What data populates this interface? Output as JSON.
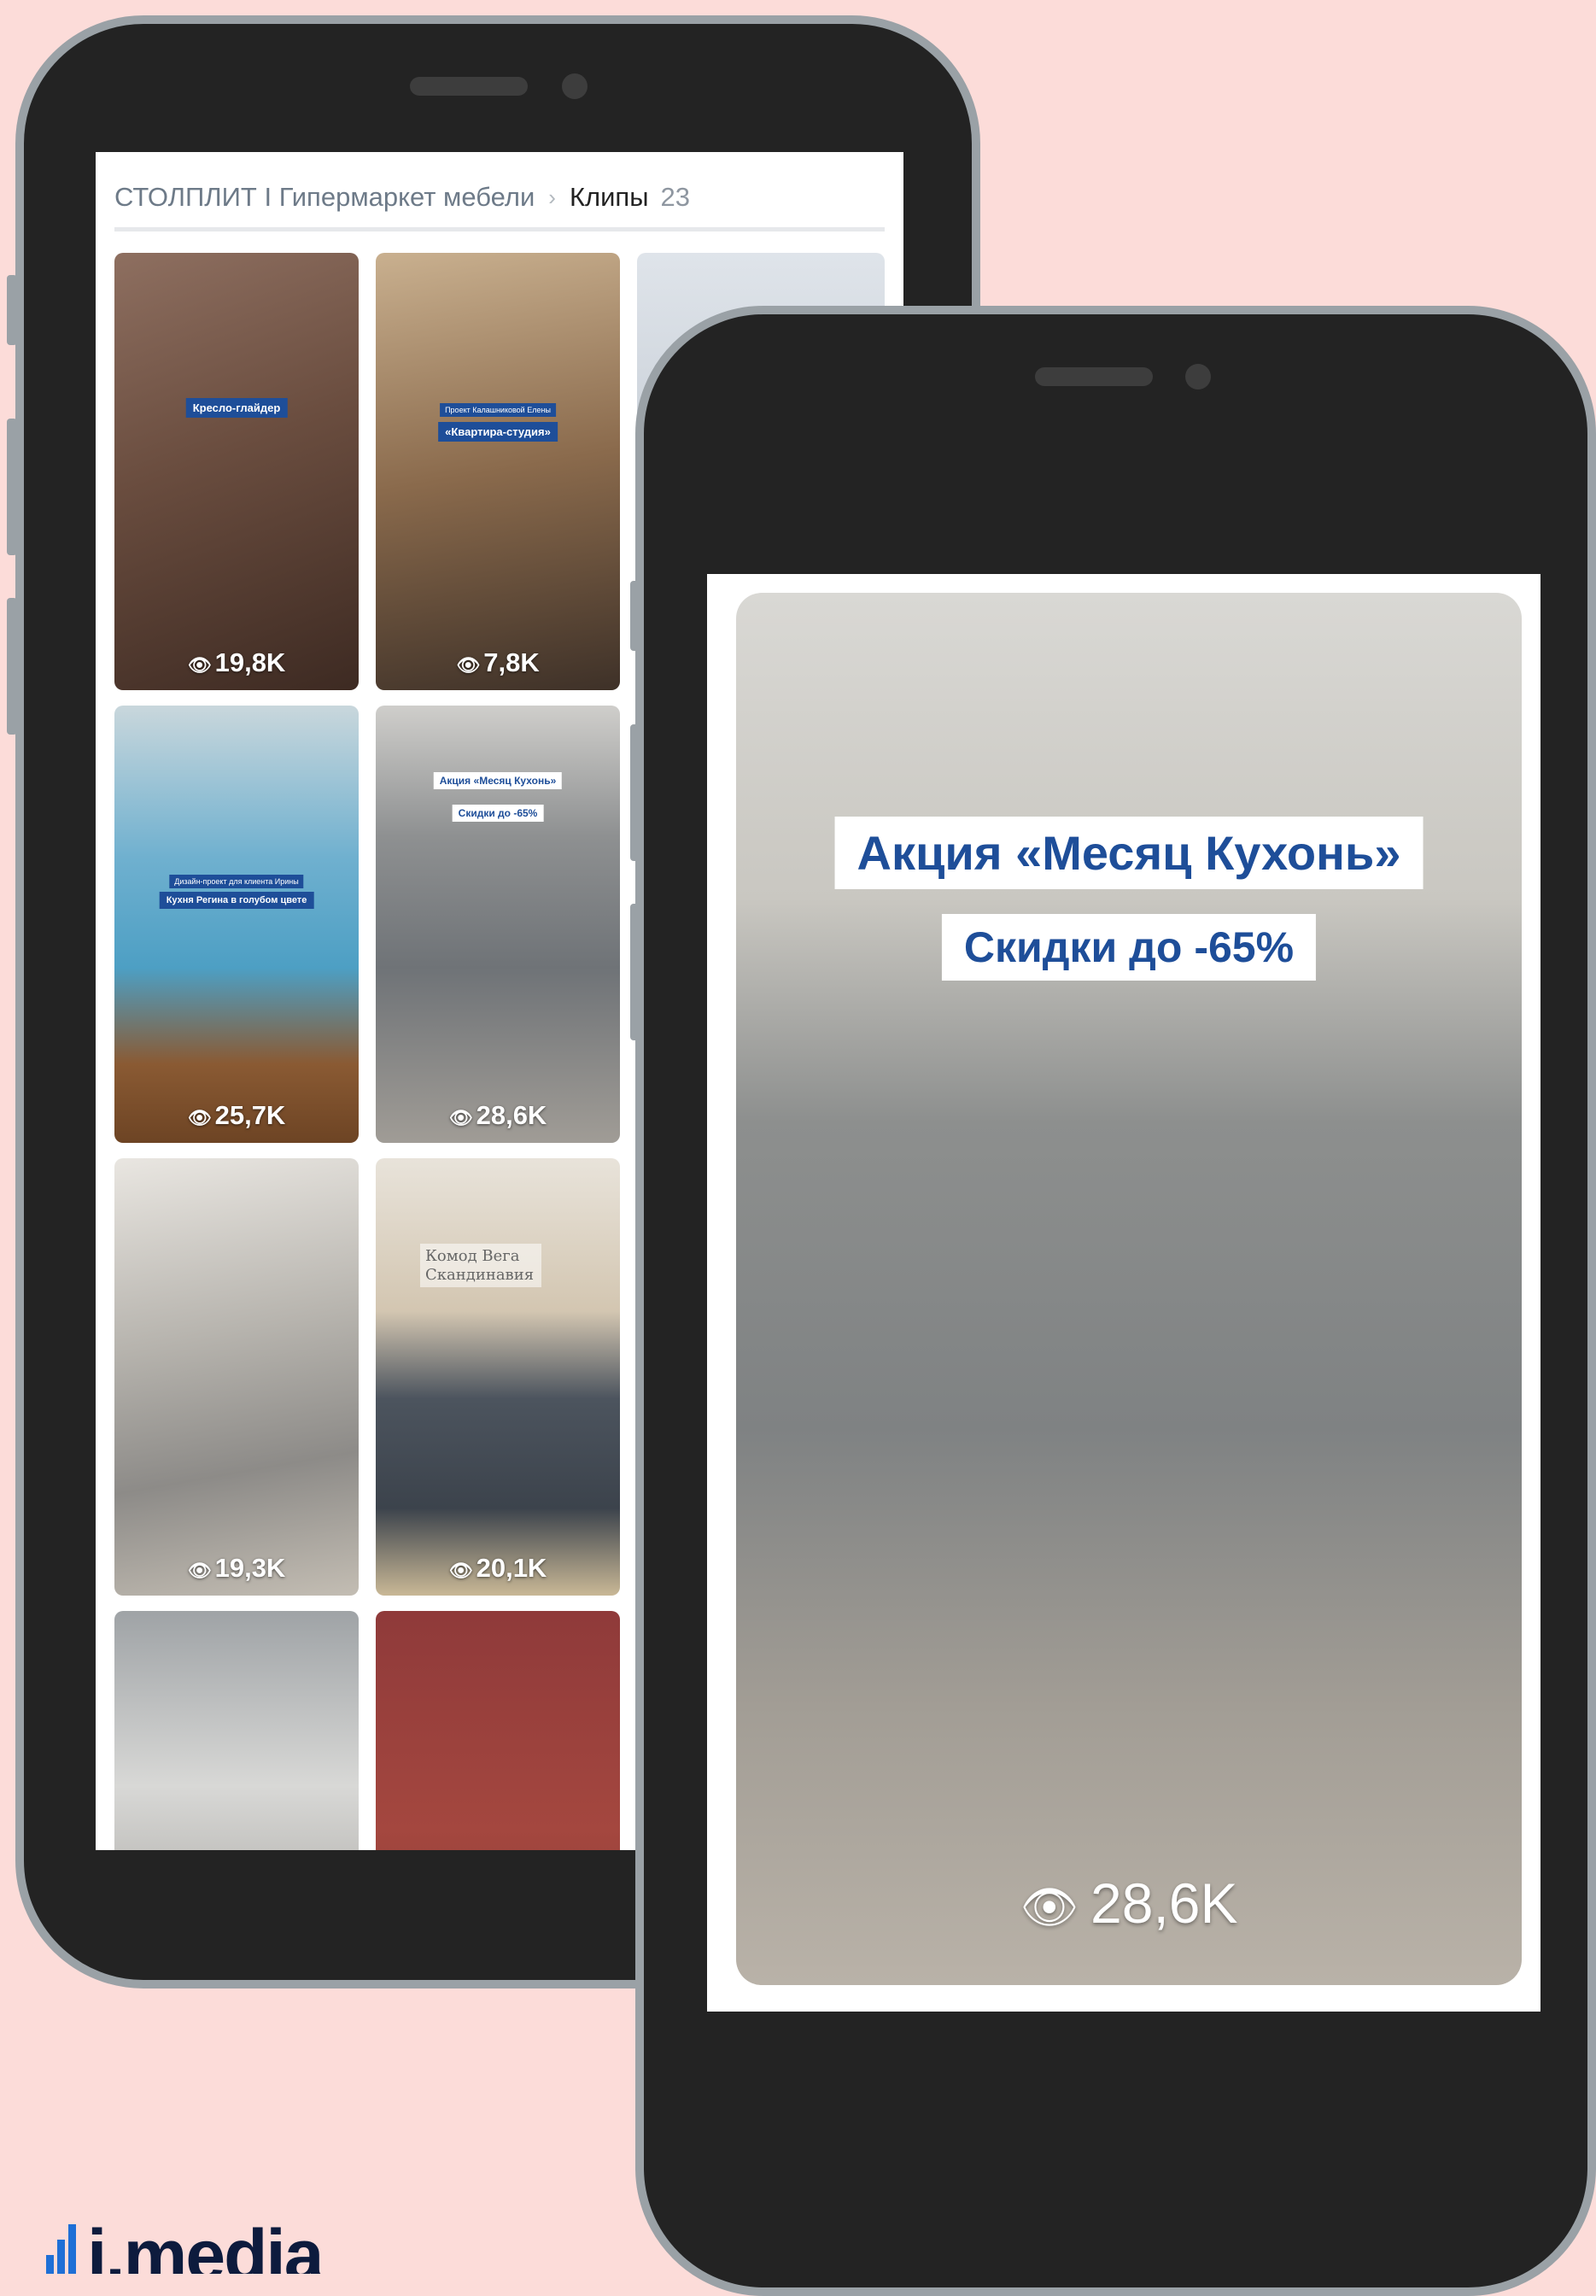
{
  "colors": {
    "background": "#fcdcd9",
    "phone_body": "#232323",
    "phone_frame": "#9aa1a6",
    "accent_blue": "#1e4e99"
  },
  "list_phone": {
    "breadcrumb": {
      "community": "СТОЛПЛИТ I Гипермаркет мебели",
      "separator": "›",
      "section": "Клипы",
      "count": "23"
    },
    "clips": [
      {
        "views": "19,8K",
        "badge": "Кресло-глайдер"
      },
      {
        "views": "7,8K",
        "badge_small": "Проект Калашниковой Елены",
        "badge": "«Квартира-студия»"
      },
      {
        "views": "25,7K",
        "badge_small": "Дизайн-проект для клиента Ирины",
        "badge": "Кухня Регина в голубом цвете"
      },
      {
        "views": "28,6K",
        "badge": "Акция «Месяц Кухонь»",
        "badge_sub": "Скидки до -65%"
      },
      {
        "views": "19,3K"
      },
      {
        "views": "20,1K",
        "caption": "Комод Вега Скандинавия"
      },
      {
        "views": ""
      },
      {
        "views": ""
      }
    ]
  },
  "detail_phone": {
    "title": "Акция «Месяц Кухонь»",
    "subtitle": "Скидки до -65%",
    "views": "28,6K",
    "view_icon": "eye-icon"
  },
  "brand": {
    "logo": "i.media"
  }
}
